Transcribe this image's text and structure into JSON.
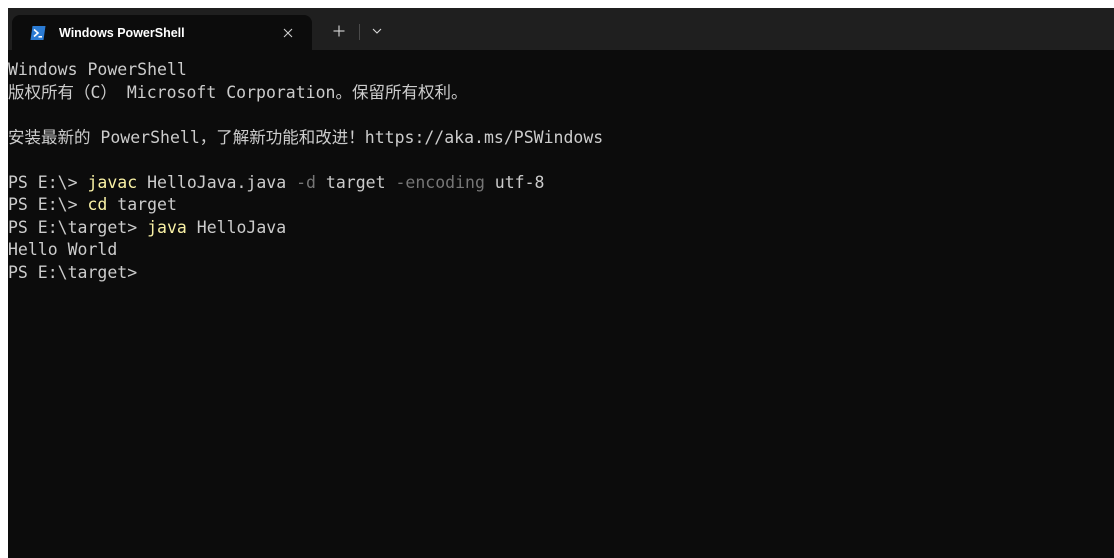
{
  "tab": {
    "title": "Windows PowerShell",
    "icon": "powershell-icon",
    "close_glyph": "×",
    "new_tab_glyph": "+",
    "dropdown_glyph": "⌄"
  },
  "colors": {
    "terminal_bg": "#0c0c0c",
    "titlebar_bg": "#1f1f1f",
    "text": "#cccccc",
    "command": "#f9f1a5",
    "parameter": "#767676"
  },
  "terminal": {
    "banner_1": "Windows PowerShell",
    "banner_2": "版权所有（C） Microsoft Corporation。保留所有权利。",
    "banner_3": "安装最新的 PowerShell，了解新功能和改进！https://aka.ms/PSWindows",
    "line1": {
      "prompt": "PS E:\\> ",
      "command": "javac",
      "arg1": " HelloJava.java ",
      "param1": "-d",
      "arg2": " target ",
      "param2": "-encoding",
      "arg3": " utf-8"
    },
    "line2": {
      "prompt": "PS E:\\> ",
      "command": "cd",
      "arg1": " target"
    },
    "line3": {
      "prompt": "PS E:\\target> ",
      "command": "java",
      "arg1": " HelloJava"
    },
    "output": "Hello World",
    "final_prompt": "PS E:\\target>"
  }
}
